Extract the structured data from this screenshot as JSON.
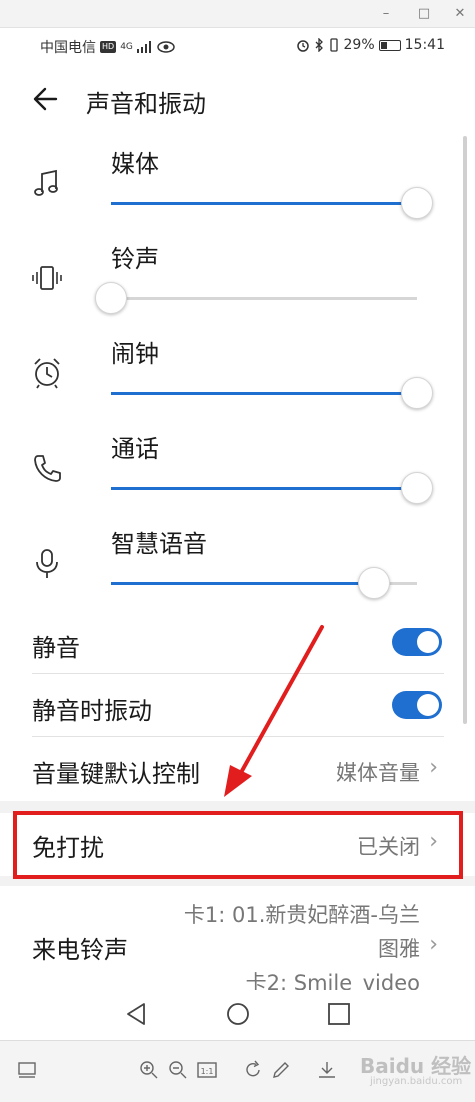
{
  "statusbar": {
    "carrier": "中国电信",
    "hd_badge": "HD",
    "signal_text": "4G",
    "battery_pct": "29%",
    "time": "15:41"
  },
  "header": {
    "title": "声音和振动"
  },
  "volumes": [
    {
      "label": "媒体",
      "icon": "music-note-icon",
      "level": 1.0
    },
    {
      "label": "铃声",
      "icon": "vibrate-icon",
      "level": 0.0
    },
    {
      "label": "闹钟",
      "icon": "alarm-clock-icon",
      "level": 1.0
    },
    {
      "label": "通话",
      "icon": "phone-icon",
      "level": 1.0
    },
    {
      "label": "智慧语音",
      "icon": "microphone-icon",
      "level": 0.86
    }
  ],
  "toggles": [
    {
      "label": "静音",
      "on": true
    },
    {
      "label": "静音时振动",
      "on": true
    }
  ],
  "volume_key": {
    "label": "音量键默认控制",
    "value": "媒体音量"
  },
  "dnd": {
    "label": "免打扰",
    "value": "已关闭"
  },
  "ringtone": {
    "label": "来电铃声",
    "line1": "卡1: 01.新贵妃醉酒-乌兰",
    "line2": "图雅",
    "line3": "卡2: Smile_video"
  },
  "viewer": {
    "watermark": "Baidu 经验",
    "watermark_sub": "jingyan.baidu.com"
  },
  "colors": {
    "accent": "#1f6fd0",
    "highlight": "#e21d1d"
  }
}
